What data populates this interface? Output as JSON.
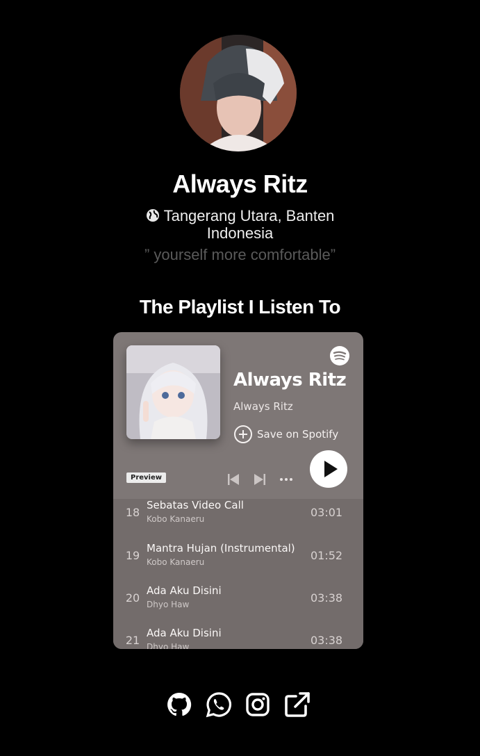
{
  "profile": {
    "name": "Always Ritz",
    "location_line1": "Tangerang Utara, Banten",
    "location_line2": "Indonesia",
    "quote_open": "”",
    "quote_text": "yourself more comfortable",
    "quote_close": "”"
  },
  "playlist_section": {
    "heading": "The Playlist I Listen To"
  },
  "player": {
    "title": "Always Ritz",
    "owner": "Always Ritz",
    "save_label": "Save on Spotify",
    "preview_label": "Preview",
    "more_label": "•••",
    "accent_color": "#7e7776"
  },
  "tracks": [
    {
      "num": "18",
      "title": "Sebatas Video Call",
      "artist": "Kobo Kanaeru",
      "duration": "03:01"
    },
    {
      "num": "19",
      "title": "Mantra Hujan (Instrumental)",
      "artist": "Kobo Kanaeru",
      "duration": "01:52"
    },
    {
      "num": "20",
      "title": "Ada Aku Disini",
      "artist": "Dhyo Haw",
      "duration": "03:38"
    },
    {
      "num": "21",
      "title": "Ada Aku Disini",
      "artist": "Dhyo Haw",
      "duration": "03:38"
    }
  ],
  "social_icons": [
    "github-icon",
    "whatsapp-icon",
    "instagram-icon",
    "external-link-icon"
  ]
}
